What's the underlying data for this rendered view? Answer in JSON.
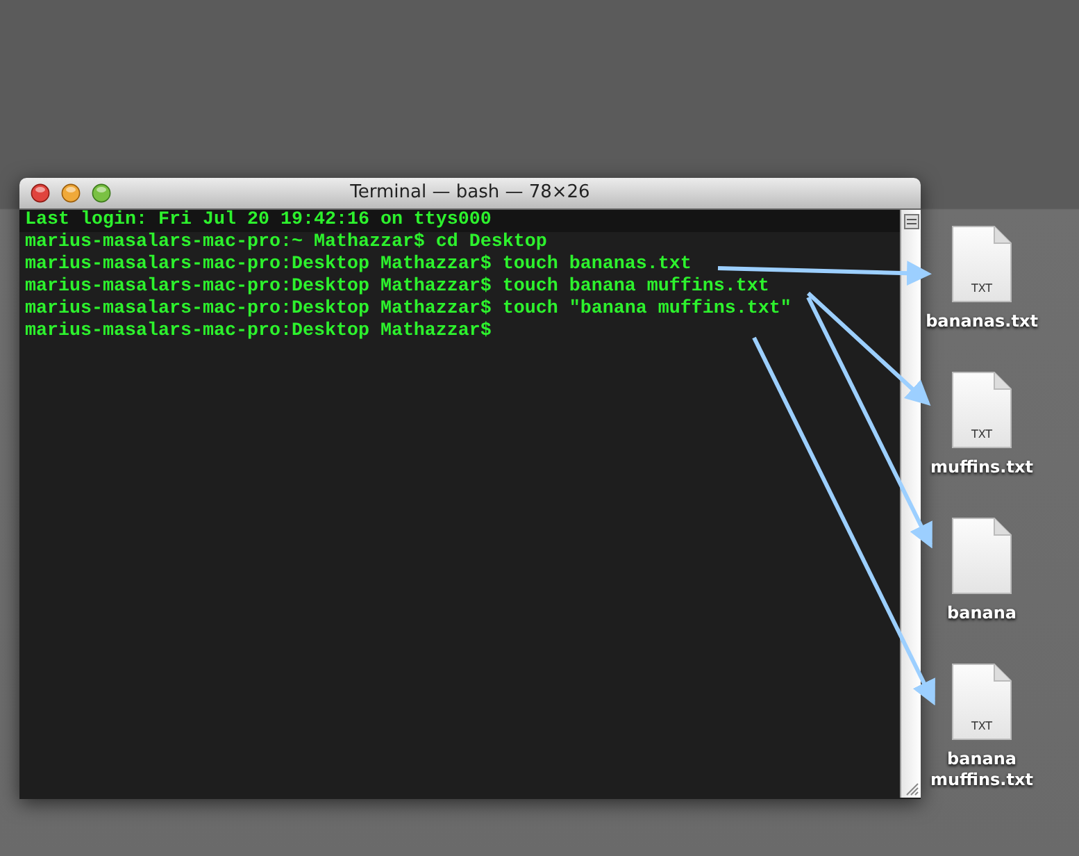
{
  "window": {
    "title": "Terminal — bash — 78×26"
  },
  "terminal": {
    "lines": [
      {
        "text": "Last login: Fri Jul 20 19:42:16 on ttys000",
        "kind": "banner"
      },
      {
        "text": "marius-masalars-mac-pro:~ Mathazzar$ cd Desktop",
        "kind": "line"
      },
      {
        "text": "marius-masalars-mac-pro:Desktop Mathazzar$ touch bananas.txt",
        "kind": "line"
      },
      {
        "text": "marius-masalars-mac-pro:Desktop Mathazzar$ touch banana muffins.txt",
        "kind": "line"
      },
      {
        "text": "marius-masalars-mac-pro:Desktop Mathazzar$ touch \"banana muffins.txt\"",
        "kind": "line"
      },
      {
        "text": "marius-masalars-mac-pro:Desktop Mathazzar$",
        "kind": "line"
      }
    ]
  },
  "desktop_icons": [
    {
      "label": "bananas.txt",
      "badge": "TXT"
    },
    {
      "label": "muffins.txt",
      "badge": "TXT"
    },
    {
      "label": "banana"
    },
    {
      "label": "banana muffins.txt",
      "badge": "TXT"
    }
  ]
}
